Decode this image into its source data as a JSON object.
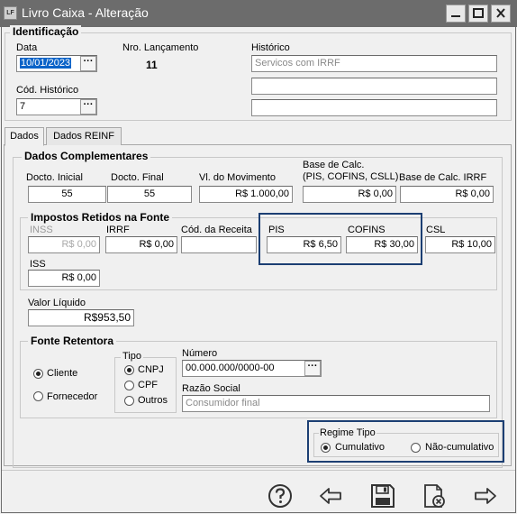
{
  "window": {
    "title": "Livro Caixa - Alteração",
    "app_icon": "LF"
  },
  "identificacao": {
    "legend": "Identificação",
    "data_label": "Data",
    "data_value": "10/01/2023",
    "nro_label": "Nro. Lançamento",
    "nro_value": "11",
    "historico_label": "Histórico",
    "historico_value": "Servicos com IRRF",
    "historico_line2": "",
    "historico_line3": "",
    "cod_historico_label": "Cód. Histórico",
    "cod_historico_value": "7",
    "dots": "···"
  },
  "tabs": [
    "Dados",
    "Dados REINF"
  ],
  "dados_complementares": {
    "legend": "Dados Complementares",
    "docto_inicial_label": "Docto. Inicial",
    "docto_inicial_value": "55",
    "docto_final_label": "Docto. Final",
    "docto_final_value": "55",
    "vl_movimento_label": "Vl. do Movimento",
    "vl_movimento_value": "R$ 1.000,00",
    "base_calc_label_1": "Base  de Calc.",
    "base_calc_label_2": "(PIS, COFINS, CSLL)",
    "base_calc_value": "R$ 0,00",
    "base_irrf_label": "Base de Calc. IRRF",
    "base_irrf_value": "R$ 0,00"
  },
  "impostos": {
    "legend": "Impostos Retidos na Fonte",
    "inss_label": "INSS",
    "inss_value": "R$ 0,00",
    "irrf_label": "IRRF",
    "irrf_value": "R$ 0,00",
    "cod_receita_label": "Cód. da Receita",
    "cod_receita_value": "",
    "pis_label": "PIS",
    "pis_value": "R$ 6,50",
    "cofins_label": "COFINS",
    "cofins_value": "R$ 30,00",
    "csl_label": "CSL",
    "csl_value": "R$ 10,00",
    "iss_label": "ISS",
    "iss_value": "R$ 0,00"
  },
  "valor_liquido": {
    "label": "Valor Líquido",
    "value": "R$953,50"
  },
  "fonte_retentora": {
    "legend": "Fonte Retentora",
    "cliente_label": "Cliente",
    "fornecedor_label": "Fornecedor",
    "tipo_legend": "Tipo",
    "cnpj_label": "CNPJ",
    "cpf_label": "CPF",
    "outros_label": "Outros",
    "numero_label": "Número",
    "numero_value": "00.000.000/0000-00",
    "razao_label": "Razão Social",
    "razao_value": "Consumidor final"
  },
  "regime": {
    "legend": "Regime Tipo",
    "cumulativo_label": "Cumulativo",
    "nao_cumulativo_label": "Não-cumulativo"
  },
  "colors": {
    "titlebar": "#6c6c6c",
    "highlight_border": "#1c3f73",
    "selection": "#0a63c8"
  },
  "icons": [
    "help-icon",
    "back-arrow-icon",
    "save-icon",
    "cancel-icon",
    "forward-arrow-icon"
  ]
}
